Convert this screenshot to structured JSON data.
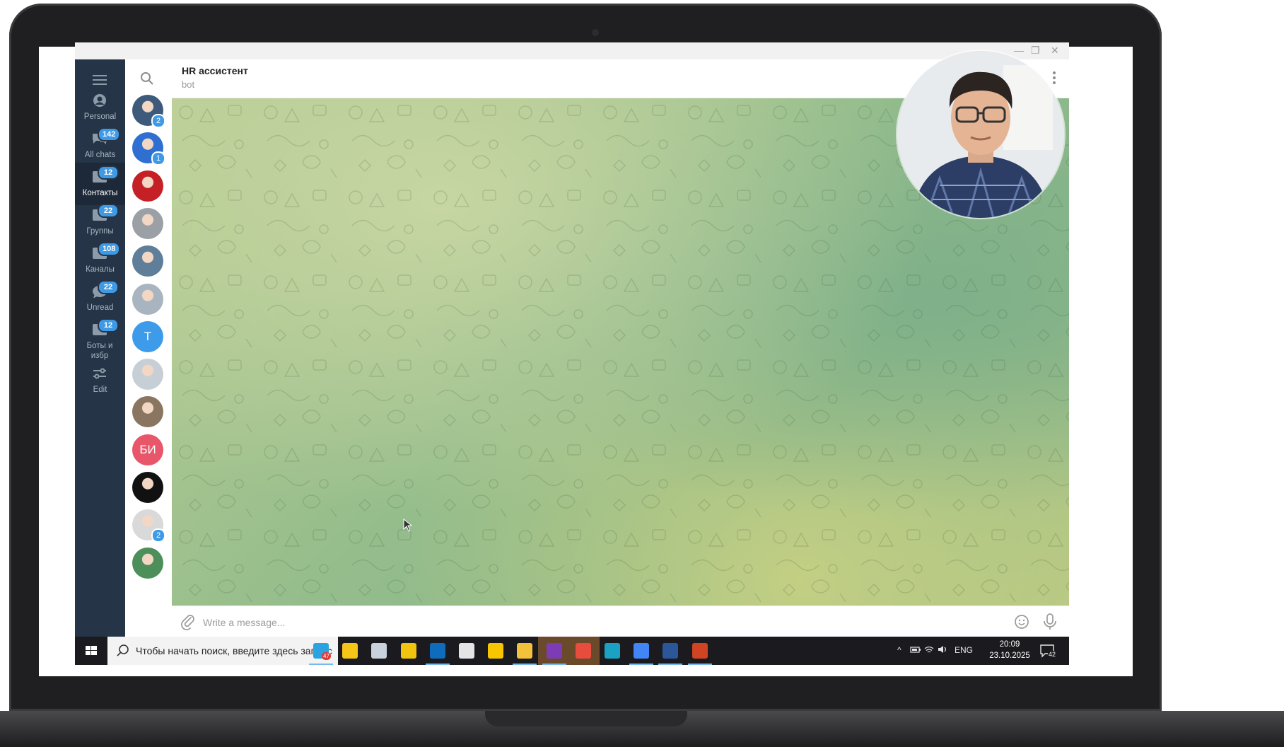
{
  "window": {
    "controls": [
      "—",
      "❐",
      "✕"
    ]
  },
  "folders": [
    {
      "label": "Personal",
      "badge": "",
      "icon": "person-icon"
    },
    {
      "label": "All chats",
      "badge": "142",
      "icon": "chats-icon"
    },
    {
      "label": "Контакты",
      "badge": "12",
      "icon": "folder-icon",
      "active": true
    },
    {
      "label": "Группы",
      "badge": "22",
      "icon": "folder-icon"
    },
    {
      "label": "Каналы",
      "badge": "108",
      "icon": "folder-icon"
    },
    {
      "label": "Unread",
      "badge": "22",
      "icon": "chat-bubble-icon"
    },
    {
      "label": "Боты и избр",
      "badge": "12",
      "icon": "folder-icon"
    },
    {
      "label": "Edit",
      "badge": "",
      "icon": "edit-filters-icon"
    }
  ],
  "chat_list": [
    {
      "type": "photo",
      "badge": "2",
      "color": "#3d5a7a"
    },
    {
      "type": "photo",
      "badge": "1",
      "color": "#2f6fd1"
    },
    {
      "type": "photo",
      "badge": "",
      "color": "#c52026"
    },
    {
      "type": "photo",
      "badge": "",
      "color": "#9aa0a6"
    },
    {
      "type": "photo",
      "badge": "",
      "color": "#5e7e99"
    },
    {
      "type": "photo",
      "badge": "",
      "color": "#a8b5c0"
    },
    {
      "type": "letter",
      "text": "T",
      "badge": "",
      "color": "#3e9be9"
    },
    {
      "type": "photo",
      "badge": "",
      "color": "#c7cfd6"
    },
    {
      "type": "photo",
      "badge": "",
      "color": "#8a7560"
    },
    {
      "type": "letter",
      "text": "БИ",
      "badge": "",
      "color": "#e8566a"
    },
    {
      "type": "photo",
      "badge": "",
      "color": "#111111"
    },
    {
      "type": "photo",
      "badge": "2",
      "color": "#d9d9d9"
    },
    {
      "type": "photo",
      "badge": "",
      "color": "#4d8f5a"
    }
  ],
  "chat": {
    "title": "HR ассистент",
    "subtitle": "bot"
  },
  "composer": {
    "placeholder": "Write a message..."
  },
  "taskbar": {
    "search_placeholder": "Чтобы начать поиск, введите здесь запрос",
    "apps": [
      {
        "name": "telegram",
        "color": "#2aa3e0",
        "open": true,
        "badge": "47"
      },
      {
        "name": "favorites",
        "color": "#f5c518"
      },
      {
        "name": "app-bird",
        "color": "#c8d2dc"
      },
      {
        "name": "app-bookmark",
        "color": "#f1c40f"
      },
      {
        "name": "outlook",
        "color": "#0f6cbd",
        "open": true
      },
      {
        "name": "app-tool",
        "color": "#e5e5e5"
      },
      {
        "name": "app-1c",
        "color": "#f7c600"
      },
      {
        "name": "file-explorer",
        "color": "#f3c13a",
        "open": true
      },
      {
        "name": "onenote",
        "color": "#7d3cb5",
        "open": true,
        "highlight": true
      },
      {
        "name": "app-snip",
        "color": "#e84c3d",
        "highlight": true
      },
      {
        "name": "app-wave",
        "color": "#1aa1c4"
      },
      {
        "name": "chrome",
        "color": "#4285f4",
        "open": true
      },
      {
        "name": "word",
        "color": "#2b579a",
        "open": true
      },
      {
        "name": "powerpoint",
        "color": "#d04423",
        "open": true
      }
    ],
    "tray": {
      "chevron": "^",
      "lang": "ENG",
      "time": "20:09",
      "date": "23.10.2025",
      "notifications": "42"
    }
  }
}
